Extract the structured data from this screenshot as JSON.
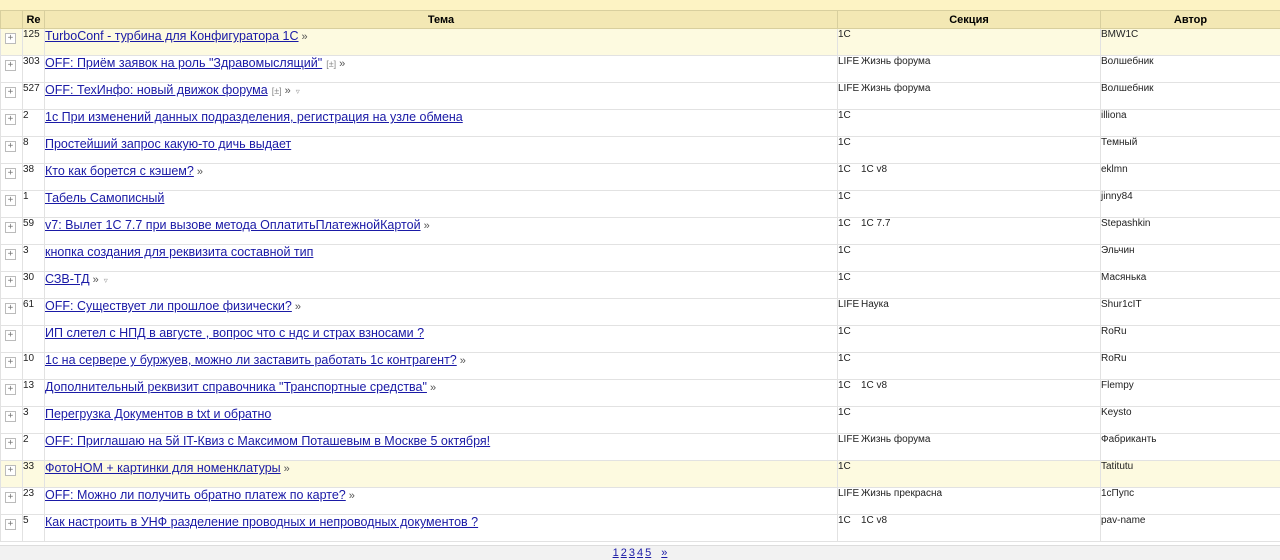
{
  "headers": {
    "re": "Re",
    "topic": "Тема",
    "section": "Секция",
    "author": "Автор"
  },
  "expand_glyph": "+",
  "rows": [
    {
      "re": "125",
      "title": "TurboConf - турбина для Конфигуратора 1С",
      "arrow": "»",
      "pm": "",
      "tri": "",
      "sec1": "1С",
      "sec2": "",
      "author": "BMW1C",
      "hl": true
    },
    {
      "re": "303",
      "title": "OFF: Приём заявок на роль \"Здравомыслящий\"",
      "arrow": "»",
      "pm": "[±]",
      "tri": "",
      "sec1": "LIFE",
      "sec2": "Жизнь форума",
      "author": "Волшебник",
      "hl": false
    },
    {
      "re": "527",
      "title": "OFF: ТехИнфо: новый движок форума",
      "arrow": "»",
      "pm": "[±]",
      "tri": "▿",
      "sec1": "LIFE",
      "sec2": "Жизнь форума",
      "author": "Волшебник",
      "hl": false
    },
    {
      "re": "2",
      "title": "1с При изменений данных подразделения, регистрация на узле обмена",
      "arrow": "",
      "pm": "",
      "tri": "",
      "sec1": "1С",
      "sec2": "",
      "author": "illiona",
      "hl": false
    },
    {
      "re": "8",
      "title": "Простейший запрос какую-то дичь выдает",
      "arrow": "",
      "pm": "",
      "tri": "",
      "sec1": "1С",
      "sec2": "",
      "author": "Темный",
      "hl": false
    },
    {
      "re": "38",
      "title": "Кто как борется с кэшем?",
      "arrow": "»",
      "pm": "",
      "tri": "",
      "sec1": "1С",
      "sec2": "1С v8",
      "author": "eklmn",
      "hl": false
    },
    {
      "re": "1",
      "title": "Табель Самописный",
      "arrow": "",
      "pm": "",
      "tri": "",
      "sec1": "1С",
      "sec2": "",
      "author": "jinny84",
      "hl": false
    },
    {
      "re": "59",
      "title": "v7: Вылет 1С 7.7 при вызове метода ОплатитьПлатежнойКартой",
      "arrow": "»",
      "pm": "",
      "tri": "",
      "sec1": "1С",
      "sec2": "1С 7.7",
      "author": "Stepashkin",
      "hl": false
    },
    {
      "re": "3",
      "title": "кнопка создания для реквизита составной тип",
      "arrow": "",
      "pm": "",
      "tri": "",
      "sec1": "1С",
      "sec2": "",
      "author": "Эльчин",
      "hl": false
    },
    {
      "re": "30",
      "title": "СЗВ-ТД",
      "arrow": "»",
      "pm": "",
      "tri": "▿",
      "sec1": "1С",
      "sec2": "",
      "author": "Масянька",
      "hl": false
    },
    {
      "re": "61",
      "title": "OFF: Существует ли прошлое физически?",
      "arrow": "»",
      "pm": "",
      "tri": "",
      "sec1": "LIFE",
      "sec2": "Наука",
      "author": "Shur1cIT",
      "hl": false
    },
    {
      "re": "",
      "title": "ИП слетел с НПД в августе , вопрос что с ндс и страх взносами ?",
      "arrow": "",
      "pm": "",
      "tri": "",
      "sec1": "1С",
      "sec2": "",
      "author": "RoRu",
      "hl": false
    },
    {
      "re": "10",
      "title": "1с на сервере у буржуев, можно ли заставить работать 1с контрагент?",
      "arrow": "»",
      "pm": "",
      "tri": "",
      "sec1": "1С",
      "sec2": "",
      "author": "RoRu",
      "hl": false
    },
    {
      "re": "13",
      "title": "Дополнительный реквизит справочника \"Транспортные средства\"",
      "arrow": "»",
      "pm": "",
      "tri": "",
      "sec1": "1С",
      "sec2": "1С v8",
      "author": "Flempy",
      "hl": false
    },
    {
      "re": "3",
      "title": "Перегрузка Документов в txt и обратно",
      "arrow": "",
      "pm": "",
      "tri": "",
      "sec1": "1С",
      "sec2": "",
      "author": "Keysto",
      "hl": false
    },
    {
      "re": "2",
      "title": "OFF: Приглашаю на 5й IT-Квиз с Максимом Поташевым в Москве 5 октября!",
      "arrow": "",
      "pm": "",
      "tri": "",
      "sec1": "LIFE",
      "sec2": "Жизнь форума",
      "author": "Фабриканть",
      "hl": false
    },
    {
      "re": "33",
      "title": "ФотоНОМ + картинки для номенклатуры",
      "arrow": "»",
      "pm": "",
      "tri": "",
      "sec1": "1С",
      "sec2": "",
      "author": "Tatitutu",
      "hl": true
    },
    {
      "re": "23",
      "title": "OFF: Можно ли получить обратно платеж по карте?",
      "arrow": "»",
      "pm": "",
      "tri": "",
      "sec1": "LIFE",
      "sec2": "Жизнь прекрасна",
      "author": "1сПупс",
      "hl": false
    },
    {
      "re": "5",
      "title": "Как настроить в УНФ разделение проводных и непроводных документов ?",
      "arrow": "",
      "pm": "",
      "tri": "",
      "sec1": "1С",
      "sec2": "1С v8",
      "author": "pav-name",
      "hl": false
    }
  ],
  "pager": {
    "pages": [
      "1",
      "2",
      "3",
      "4",
      "5"
    ],
    "next": "»"
  }
}
